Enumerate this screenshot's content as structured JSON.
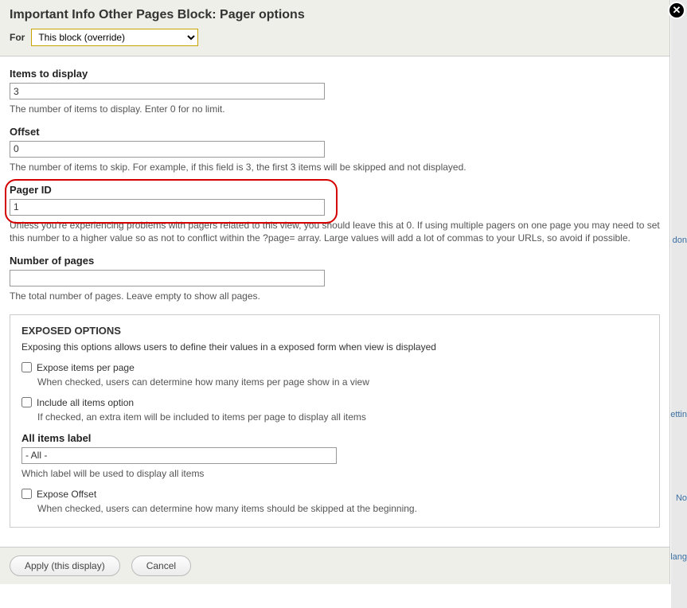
{
  "header": {
    "title": "Important Info Other Pages Block: Pager options",
    "for_label": "For",
    "for_selected": "This block (override)"
  },
  "fields": {
    "items_to_display": {
      "label": "Items to display",
      "value": "3",
      "desc": "The number of items to display. Enter 0 for no limit."
    },
    "offset": {
      "label": "Offset",
      "value": "0",
      "desc": "The number of items to skip. For example, if this field is 3, the first 3 items will be skipped and not displayed."
    },
    "pager_id": {
      "label": "Pager ID",
      "value": "1",
      "desc": "Unless you're experiencing problems with pagers related to this view, you should leave this at 0. If using multiple pagers on one page you may need to set this number to a higher value so as not to conflict within the ?page= array. Large values will add a lot of commas to your URLs, so avoid if possible."
    },
    "number_of_pages": {
      "label": "Number of pages",
      "value": "",
      "desc": "The total number of pages. Leave empty to show all pages."
    }
  },
  "exposed": {
    "title": "EXPOSED OPTIONS",
    "desc": "Exposing this options allows users to define their values in a exposed form when view is displayed",
    "expose_items": {
      "label": "Expose items per page",
      "desc": "When checked, users can determine how many items per page show in a view"
    },
    "include_all": {
      "label": "Include all items option",
      "desc": "If checked, an extra item will be included to items per page to display all items"
    },
    "all_items_label": {
      "label": "All items label",
      "value": "- All -",
      "desc": "Which label will be used to display all items"
    },
    "expose_offset": {
      "label": "Expose Offset",
      "desc": "When checked, users can determine how many items should be skipped at the beginning."
    }
  },
  "footer": {
    "apply": "Apply (this display)",
    "cancel": "Cancel"
  },
  "right_hints": [
    "don",
    "ettin",
    "No",
    "lang"
  ]
}
